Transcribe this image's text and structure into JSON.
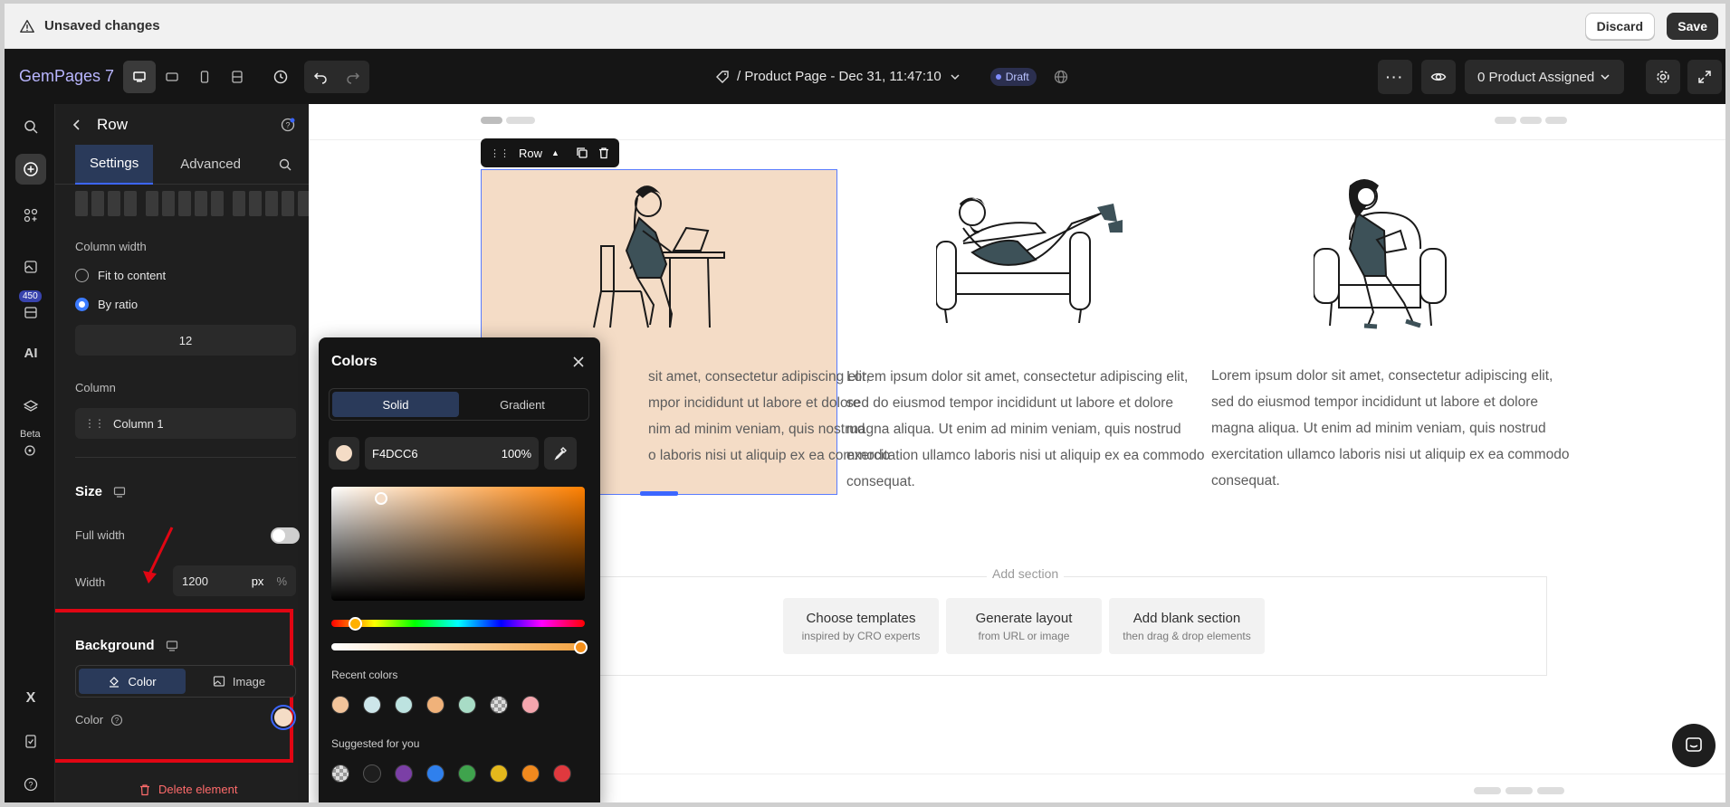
{
  "unsaved_bar": {
    "title": "Unsaved changes",
    "discard_label": "Discard",
    "save_label": "Save"
  },
  "topbar": {
    "logo": "GemPages 7",
    "page_title": "/ Product Page - Dec 31, 11:47:10",
    "status_badge": "Draft",
    "product_assigned": "0 Product Assigned"
  },
  "rail": {
    "badge_count": "450",
    "beta_label": "Beta"
  },
  "panel": {
    "title": "Row",
    "tabs": [
      "Settings",
      "Advanced"
    ],
    "column_width_label": "Column width",
    "radio_fit": "Fit to content",
    "radio_ratio": "By ratio",
    "ratio_value": "12",
    "column_label": "Column",
    "column_item": "Column 1",
    "size_heading": "Size",
    "full_width_label": "Full width",
    "full_width_on": false,
    "width_label": "Width",
    "width_value": "1200",
    "width_unit_px": "px",
    "width_unit_pct": "%",
    "background_heading": "Background",
    "bg_tabs": [
      "Color",
      "Image"
    ],
    "color_label": "Color",
    "delete_label": "Delete element"
  },
  "canvas": {
    "row_tag": "Row",
    "lorem_partial": [
      "sit amet, consectetur adipiscing elit,",
      "mpor incididunt ut labore et dolore",
      "nim ad minim veniam, quis nostrud",
      "o laboris nisi ut aliquip ex ea commodo"
    ],
    "lorem_full": [
      "Lorem ipsum dolor sit amet, consectetur adipiscing elit,",
      "sed do eiusmod tempor incididunt ut labore et dolore",
      "magna aliqua. Ut enim ad minim veniam, quis nostrud",
      "exercitation ullamco laboris nisi ut aliquip ex ea commodo",
      "consequat."
    ],
    "add_section_title": "Add section",
    "add_cards": [
      {
        "title": "Choose templates",
        "sub": "inspired by CRO experts"
      },
      {
        "title": "Generate layout",
        "sub": "from URL or image"
      },
      {
        "title": "Add blank section",
        "sub": "then drag & drop elements"
      }
    ]
  },
  "colors_popup": {
    "title": "Colors",
    "tabs": [
      "Solid",
      "Gradient"
    ],
    "hex": "F4DCC6",
    "opacity": "100%",
    "recent_label": "Recent colors",
    "recent": [
      "#F2C49B",
      "#CDE6EA",
      "#BDE3E0",
      "#F0B27A",
      "#A8DCC6",
      "checker",
      "#F4A6AE"
    ],
    "suggested_label": "Suggested for you",
    "suggested": [
      "checker",
      "#1E1E1E",
      "#7B3FA6",
      "#2F80ED",
      "#3FA34D",
      "#E4B81C",
      "#F0891E",
      "#E0393E"
    ]
  },
  "colors": {
    "accent": "#3C66FF",
    "background_color": "#F4DCC6",
    "highlight": "#E10613"
  }
}
